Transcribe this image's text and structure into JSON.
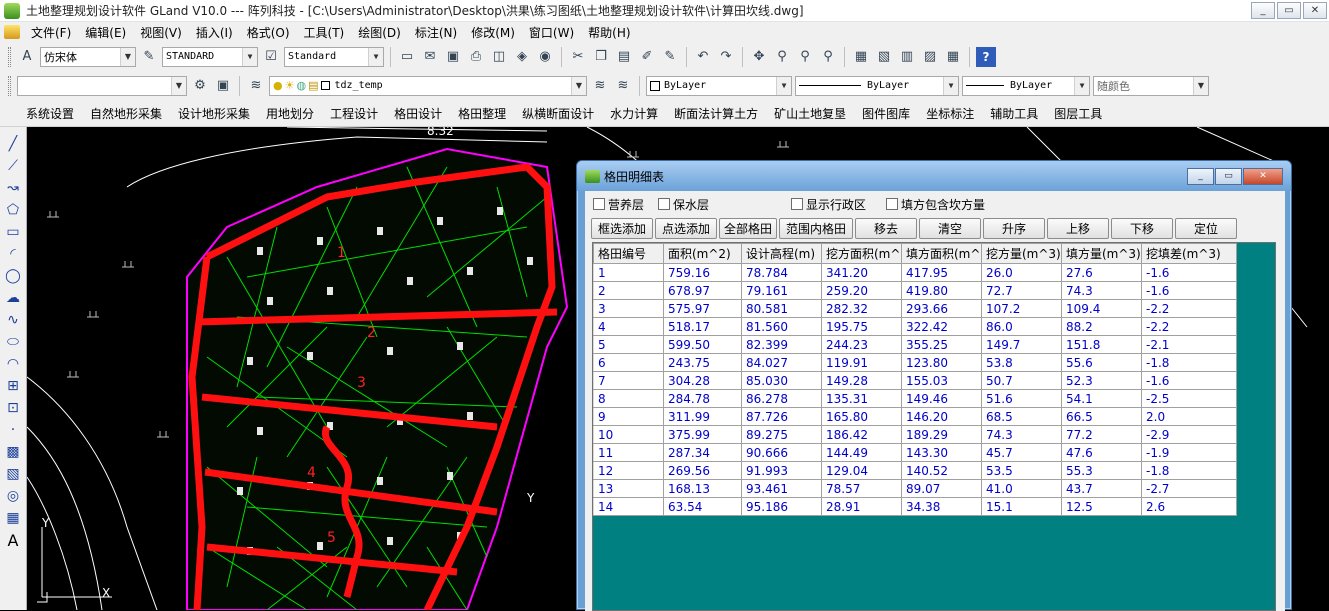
{
  "window": {
    "title": "土地整理规划设计软件 GLand V10.0 --- 阵列科技 - [C:\\Users\\Administrator\\Desktop\\洪果\\练习图纸\\土地整理规划设计软件\\计算田坎线.dwg]",
    "minimize": "_",
    "restore": "▭",
    "close": "✕"
  },
  "menu": [
    "文件(F)",
    "编辑(E)",
    "视图(V)",
    "插入(I)",
    "格式(O)",
    "工具(T)",
    "绘图(D)",
    "标注(N)",
    "修改(M)",
    "窗口(W)",
    "帮助(H)"
  ],
  "toolbar": {
    "font_value": "仿宋体",
    "text_style": "STANDARD",
    "dim_style": "Standard",
    "layer_name": "tdz_temp",
    "color": "ByLayer",
    "linetype": "ByLayer",
    "lineweight": "ByLayer",
    "plotstyle": "随颜色"
  },
  "plugins": [
    "系统设置",
    "自然地形采集",
    "设计地形采集",
    "用地划分",
    "工程设计",
    "格田设计",
    "格田整理",
    "纵横断面设计",
    "水力计算",
    "断面法计算土方",
    "矿山土地复垦",
    "图件图库",
    "坐标标注",
    "辅助工具",
    "图层工具"
  ],
  "canvas_labels": [
    "8.32",
    "Y",
    "X"
  ],
  "dialog": {
    "title": "格田明细表",
    "checkboxes": [
      "营养层",
      "保水层",
      "显示行政区",
      "填方包含坎方量"
    ],
    "buttons": [
      "框选添加",
      "点选添加",
      "全部格田",
      "范围内格田",
      "移去",
      "清空",
      "升序",
      "上移",
      "下移",
      "定位"
    ],
    "columns": [
      "格田编号",
      "面积(m^2)",
      "设计高程(m)",
      "挖方面积(m^",
      "填方面积(m^",
      "挖方量(m^3)",
      "填方量(m^3)",
      "挖填差(m^3)"
    ],
    "rows": [
      [
        "1",
        "759.16",
        "78.784",
        "341.20",
        "417.95",
        "26.0",
        "27.6",
        "-1.6"
      ],
      [
        "2",
        "678.97",
        "79.161",
        "259.20",
        "419.80",
        "72.7",
        "74.3",
        "-1.6"
      ],
      [
        "3",
        "575.97",
        "80.581",
        "282.32",
        "293.66",
        "107.2",
        "109.4",
        "-2.2"
      ],
      [
        "4",
        "518.17",
        "81.560",
        "195.75",
        "322.42",
        "86.0",
        "88.2",
        "-2.2"
      ],
      [
        "5",
        "599.50",
        "82.399",
        "244.23",
        "355.25",
        "149.7",
        "151.8",
        "-2.1"
      ],
      [
        "6",
        "243.75",
        "84.027",
        "119.91",
        "123.80",
        "53.8",
        "55.6",
        "-1.8"
      ],
      [
        "7",
        "304.28",
        "85.030",
        "149.28",
        "155.03",
        "50.7",
        "52.3",
        "-1.6"
      ],
      [
        "8",
        "284.78",
        "86.278",
        "135.31",
        "149.46",
        "51.6",
        "54.1",
        "-2.5"
      ],
      [
        "9",
        "311.99",
        "87.726",
        "165.80",
        "146.20",
        "68.5",
        "66.5",
        "2.0"
      ],
      [
        "10",
        "375.99",
        "89.275",
        "186.42",
        "189.29",
        "74.3",
        "77.2",
        "-2.9"
      ],
      [
        "11",
        "287.34",
        "90.666",
        "144.49",
        "143.30",
        "45.7",
        "47.6",
        "-1.9"
      ],
      [
        "12",
        "269.56",
        "91.993",
        "129.04",
        "140.52",
        "53.5",
        "55.3",
        "-1.8"
      ],
      [
        "13",
        "168.13",
        "93.461",
        "78.57",
        "89.07",
        "41.0",
        "43.7",
        "-2.7"
      ],
      [
        "14",
        "63.54",
        "95.186",
        "28.91",
        "34.38",
        "15.1",
        "12.5",
        "2.6"
      ]
    ]
  }
}
